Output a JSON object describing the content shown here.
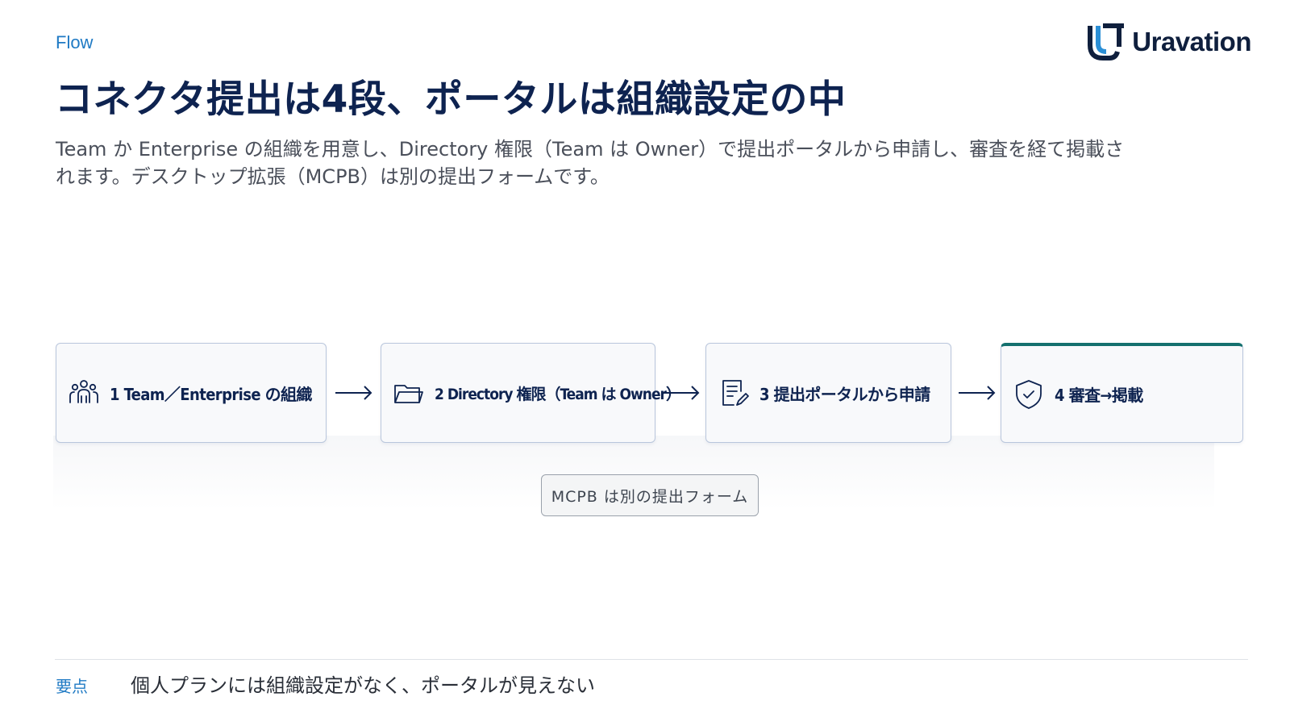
{
  "eyebrow": "Flow",
  "logo": {
    "text": "Uravation"
  },
  "title": "コネクタ提出は4段、ポータルは組織設定の中",
  "lead": "Team か Enterprise の組織を用意し、Directory 権限（Team は Owner）で提出ポータルから申請し、審査を経て掲載されます。デスクトップ拡張（MCPB）は別の提出フォームです。",
  "steps": [
    {
      "label": "1 Team／Enterprise の組織",
      "icon": "people-icon"
    },
    {
      "label": "2 Directory 権限（Team は Owner）",
      "icon": "folder-icon"
    },
    {
      "label": "3 提出ポータルから申請",
      "icon": "document-edit-icon"
    },
    {
      "label": "4 審査→掲載",
      "icon": "shield-check-icon"
    }
  ],
  "note": "MCPB は別の提出フォーム",
  "key_point": {
    "label": "要点",
    "text": "個人プランには組織設定がなく、ポータルが見えない"
  },
  "colors": {
    "accent": "#1f7ac4",
    "title": "#0e2350",
    "final_step_top": "#14706e",
    "card_border": "#b9c6dc"
  }
}
